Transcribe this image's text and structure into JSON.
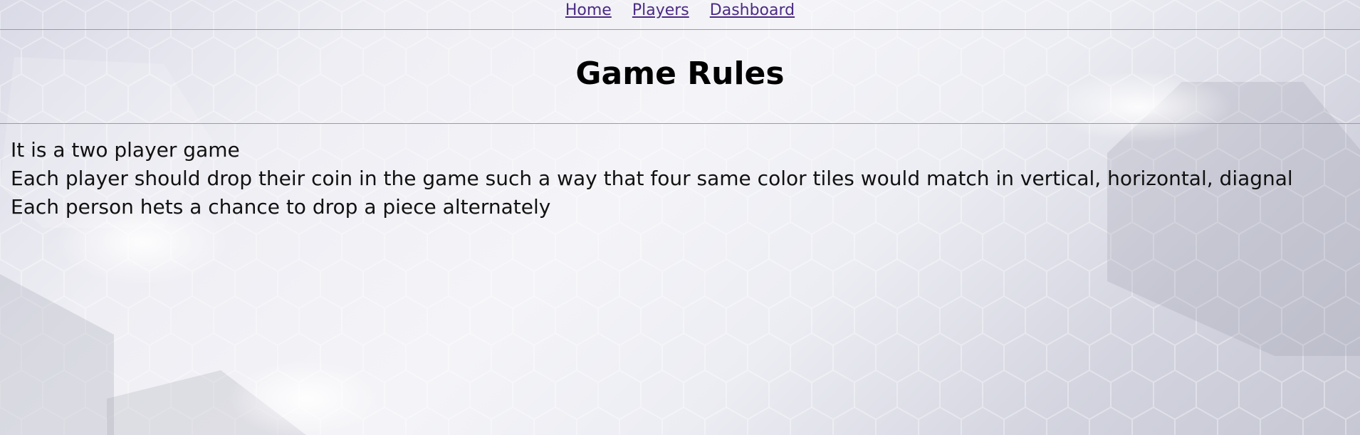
{
  "nav": {
    "links": [
      {
        "label": "Home"
      },
      {
        "label": "Players"
      },
      {
        "label": "Dashboard"
      }
    ]
  },
  "page": {
    "title": "Game Rules"
  },
  "rules": [
    "It is a two player game",
    "Each player should drop their coin in the game such a way that four same color tiles would match in vertical, horizontal, diagnal",
    "Each person hets a chance to drop a piece alternately"
  ],
  "colors": {
    "link": "#4b2a84",
    "divider": "#9a9aa6",
    "background": "#eeeef4"
  }
}
